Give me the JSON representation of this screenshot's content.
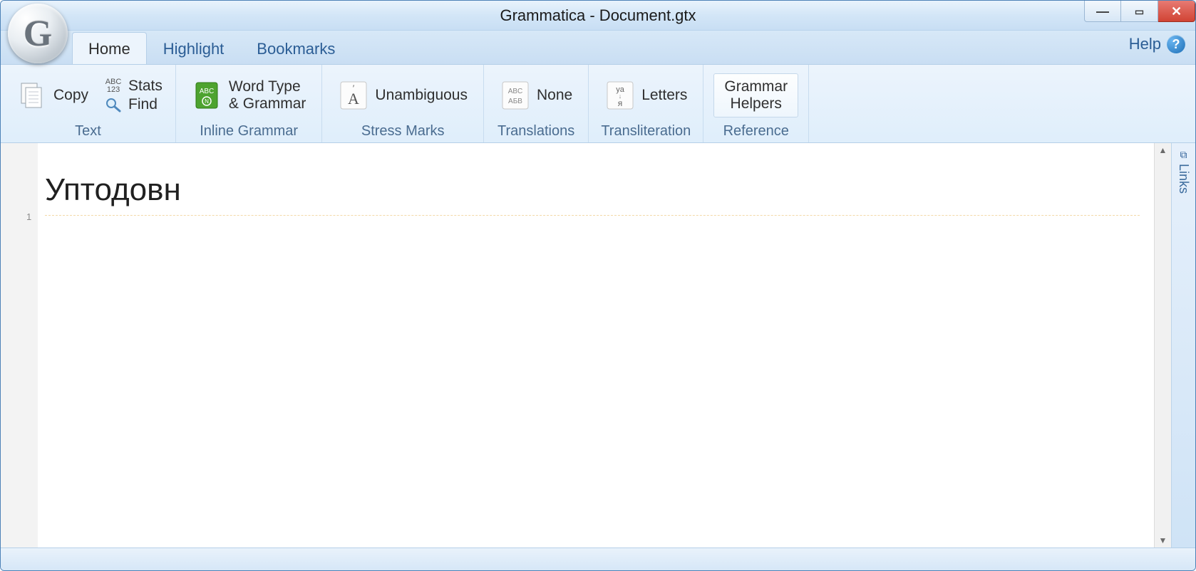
{
  "window": {
    "title": "Grammatica - Document.gtx"
  },
  "app_button": {
    "letter": "G"
  },
  "tabs": {
    "items": [
      {
        "label": "Home",
        "active": true
      },
      {
        "label": "Highlight",
        "active": false
      },
      {
        "label": "Bookmarks",
        "active": false
      }
    ],
    "help_label": "Help"
  },
  "ribbon": {
    "text_group": {
      "label": "Text",
      "copy": "Copy",
      "stats": "Stats",
      "find": "Find"
    },
    "inline_grammar_group": {
      "label": "Inline Grammar",
      "button_line1": "Word Type",
      "button_line2": "& Grammar"
    },
    "stress_marks_group": {
      "label": "Stress Marks",
      "button": "Unambiguous"
    },
    "translations_group": {
      "label": "Translations",
      "button": "None"
    },
    "transliteration_group": {
      "label": "Transliteration",
      "button": "Letters"
    },
    "reference_group": {
      "label": "Reference",
      "button_line1": "Grammar",
      "button_line2": "Helpers"
    }
  },
  "document": {
    "lines": [
      {
        "num": "1",
        "text": "Уптодовн"
      }
    ]
  },
  "sidepanel": {
    "label": "Links"
  }
}
